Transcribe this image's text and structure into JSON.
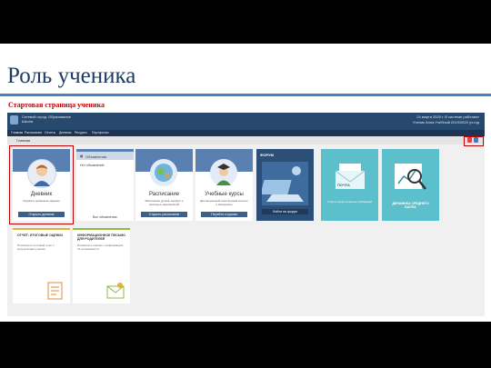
{
  "slide": {
    "title": "Роль ученика",
    "subtitle": "Стартовая страница ученика"
  },
  "app": {
    "header_logo_text_1": "Сетевой город. Образование",
    "header_logo_text_2": "Школа",
    "user_line_1": "24 марта 2020 г. В системе работают",
    "user_line_2": "Ученик Анна   Учебный 2019/2020 уч.год",
    "menu": [
      "Главная",
      "Расписание",
      "Отчеты",
      "Дневник",
      "Ресурсы",
      "Портфолио"
    ],
    "breadcrumb": "Главная"
  },
  "tiles": [
    {
      "title": "Дневник",
      "desc": "Оценки и домашние задания",
      "button": "Открыть дневник",
      "icon": "student-avatar-icon"
    },
    {
      "title": "Объявления",
      "desc": "Нет объявлений",
      "button": "Все объявления",
      "icon": "announcements-icon"
    },
    {
      "title": "Расписание",
      "desc": "Расписание уроков, каникул и школьных мероприятий",
      "button": "Открыть расписание",
      "icon": "globe-icon"
    },
    {
      "title": "Учебные курсы",
      "desc": "Дистанционный электронный контент и материалы",
      "button": "Перейти к курсам",
      "icon": "graduate-icon"
    },
    {
      "title": "ФОРУМ",
      "desc": "",
      "button": "Войти на форум",
      "icon": "forum-icon"
    },
    {
      "title": "ПОЧТА",
      "desc": "У вас 0 непрочитанных сообщений",
      "button": "",
      "icon": "mail-icon"
    },
    {
      "title": "ДИНАМИКА СРЕДНЕГО БАЛЛА",
      "desc": "",
      "button": "",
      "icon": "chart-magnifier-icon"
    }
  ],
  "bottom_tiles": [
    {
      "title": "ОТЧЕТ: ИТОГОВЫЕ ОЦЕНКИ",
      "desc": "Посмотреть итоговый отчет с результатами ученика",
      "icon": "report-icon"
    },
    {
      "title": "ИНФОРМАЦИОННОЕ ПИСЬМО ДЛЯ РОДИТЕЛЕЙ",
      "desc": "Посмотреть письмо с информацией об успеваемости",
      "icon": "letter-icon"
    }
  ]
}
